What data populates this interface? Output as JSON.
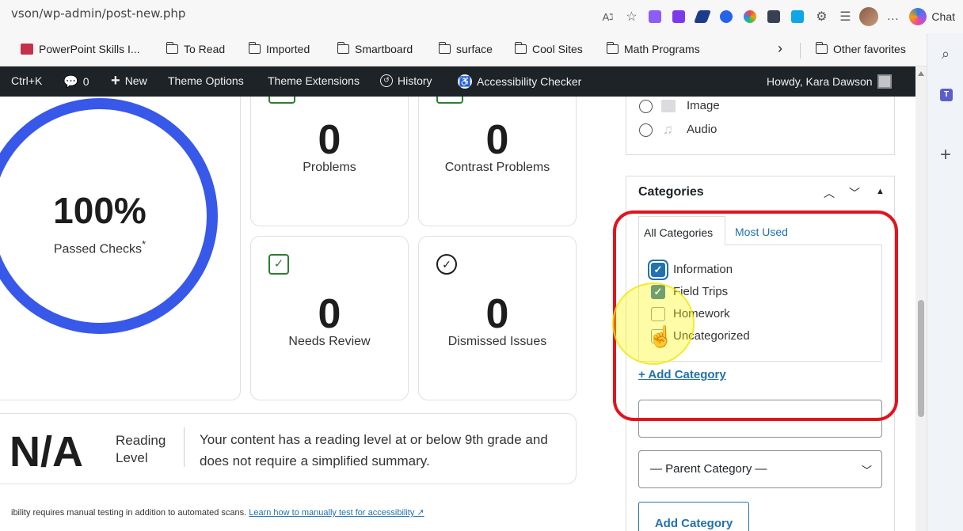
{
  "browser": {
    "url": "vson/wp-admin/post-new.php",
    "chat_label": "Chat",
    "more_label": "…",
    "bookmarks": [
      "PowerPoint Skills I...",
      "To Read",
      "Imported",
      "Smartboard",
      "surface",
      "Cool Sites",
      "Math Programs"
    ],
    "bookmarks_overflow": "›",
    "other_favorites": "Other favorites"
  },
  "wpbar": {
    "shortcut": "Ctrl+K",
    "comments_count": "0",
    "new_label": "New",
    "theme_options": "Theme Options",
    "theme_extensions": "Theme Extensions",
    "history": "History",
    "accessibility_checker": "Accessibility Checker",
    "howdy": "Howdy, Kara Dawson"
  },
  "checker": {
    "passed_percent": "100%",
    "passed_label": "Passed Checks",
    "passed_asterisk": "*",
    "problems_count": "0",
    "problems_label": "Problems",
    "contrast_count": "0",
    "contrast_label": "Contrast Problems",
    "review_count": "0",
    "review_label": "Needs Review",
    "dismissed_count": "0",
    "dismissed_label": "Dismissed Issues",
    "reading_value": "N/A",
    "reading_label_1": "Reading",
    "reading_label_2": "Level",
    "reading_desc": "Your content has a reading level at or below 9th grade and does not require a simplified summary.",
    "footnote_text": "ibility requires manual testing in addition to automated scans.",
    "footnote_link": "Learn how to manually test for accessibility ↗"
  },
  "format": {
    "options": [
      "Image",
      "Audio"
    ]
  },
  "categories": {
    "title": "Categories",
    "tab_all": "All Categories",
    "tab_used": "Most Used",
    "items": [
      {
        "label": "Information",
        "checked": true
      },
      {
        "label": "Field Trips",
        "checked": true
      },
      {
        "label": "Homework",
        "checked": false
      },
      {
        "label": "Uncategorized",
        "checked": false
      }
    ],
    "add_link": "+ Add Category",
    "new_category_value": "",
    "parent_select": "— Parent Category —",
    "add_button": "Add Category"
  },
  "colors": {
    "wp_bar": "#1d2327",
    "accent": "#2271b1",
    "progress_ring": "#3858e9",
    "highlight_box": "#e0141e"
  }
}
